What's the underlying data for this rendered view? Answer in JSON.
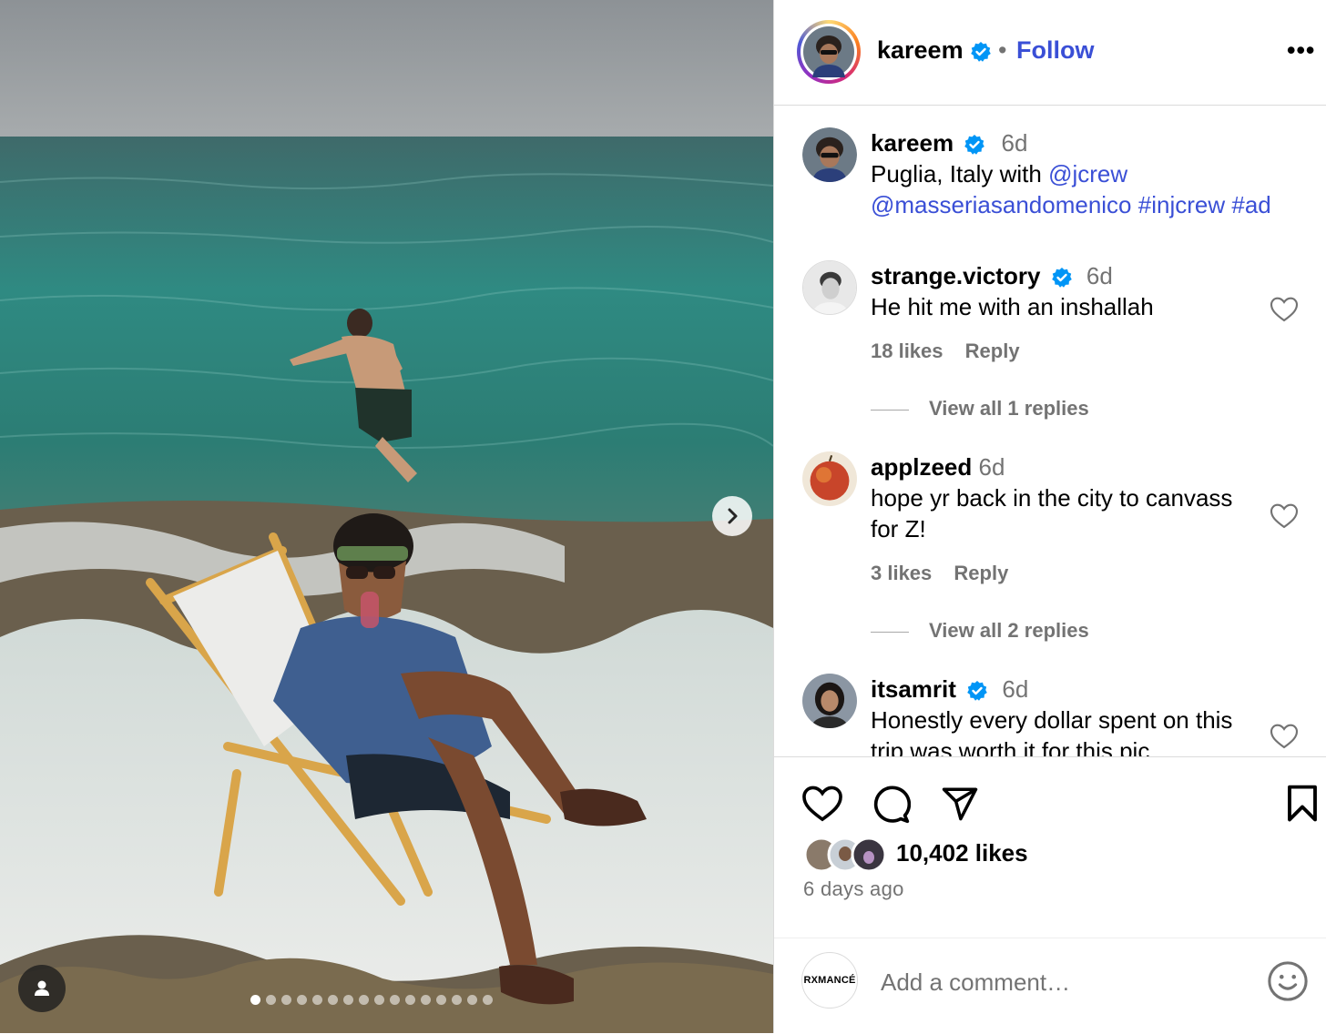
{
  "header": {
    "username": "kareem",
    "dot": "•",
    "follow_label": "Follow",
    "more_label": "•••"
  },
  "caption": {
    "username": "kareem",
    "time": "6d",
    "text_prefix": "Puglia, Italy with ",
    "mention1": "@jcrew",
    "mention2": "@masseriasandomenico",
    "hashtag1": "#injcrew",
    "hashtag2": "#ad"
  },
  "comments": [
    {
      "username": "strange.victory",
      "time": "6d",
      "lines": [
        "He hit me with an inshallah"
      ],
      "likes": "18 likes",
      "reply": "Reply",
      "view_replies": "View all 1 replies"
    },
    {
      "username": "applzeed",
      "time": "6d",
      "lines": [
        "hope yr back in the city to canvass",
        "for Z!"
      ],
      "likes": "3 likes",
      "reply": "Reply",
      "view_replies": "View all 2 replies"
    },
    {
      "username": "itsamrit",
      "time": "6d",
      "lines": [
        "Honestly every dollar spent on this",
        "trip was worth it for this pic"
      ]
    }
  ],
  "likes_count": "10,402 likes",
  "time_ago": "6 days ago",
  "add_comment": {
    "brand_avatar_text": "RXMANCÉ",
    "placeholder": "Add a comment…"
  },
  "carousel": {
    "slide_count": 16,
    "active_slide": 1
  },
  "icons": [
    "heart-icon",
    "comment-icon",
    "share-icon",
    "bookmark-icon",
    "verified-badge-icon",
    "chevron-right-icon",
    "user-tag-icon",
    "emoji-icon"
  ],
  "colors": {
    "link": "#3a4fd6",
    "verified": "#0095f6",
    "muted": "#737373"
  }
}
